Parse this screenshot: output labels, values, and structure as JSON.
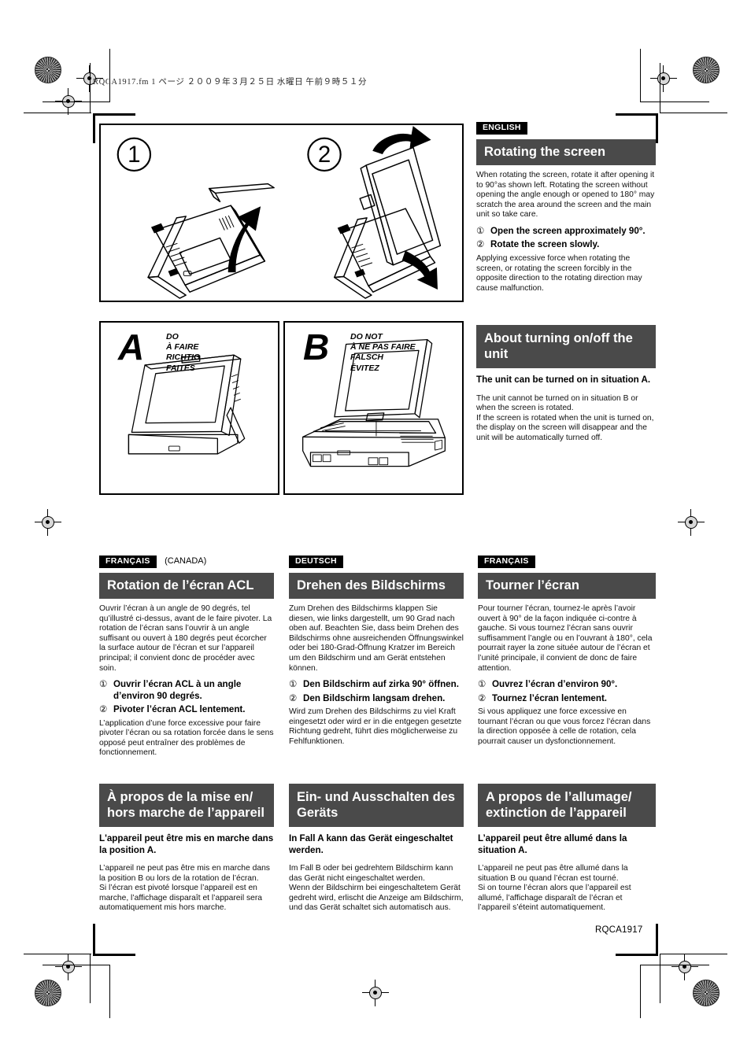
{
  "document": {
    "file_header": "RQCA1917.fm   1 ページ   ２００９年３月２５日   水曜日   午前９時５１分",
    "part_number": "RQCA1917"
  },
  "figures": {
    "rotate_panel": {
      "step1_marker": "1",
      "step2_marker": "2"
    },
    "situation_a": {
      "letter": "A",
      "caption": "DO\nÀ FAIRE\nRICHTIG\nFAITES"
    },
    "situation_b": {
      "letter": "B",
      "caption": "DO NOT\nÀ NE PAS FAIRE\nFALSCH\nÉVITEZ"
    }
  },
  "sections": {
    "english_rotate": {
      "lang_tag": "ENGLISH",
      "lang_tag_extra": "",
      "heading": "Rotating the screen",
      "intro": "When rotating the screen, rotate it after opening it to 90°as shown left. Rotating the screen without opening the angle enough or opened to 180° may scratch the area around the screen and the main unit so take care.",
      "steps": [
        {
          "num": "①",
          "label": "Open the screen approximately 90°."
        },
        {
          "num": "②",
          "label": "Rotate the screen slowly."
        }
      ],
      "outro": "Applying excessive force when rotating the screen, or rotating the screen forcibly in the opposite direction to the rotating direction may cause malfunction."
    },
    "english_power": {
      "heading": "About turning on/off the unit",
      "lead": "The unit can be turned on in situation A.",
      "body": "The unit cannot be turned on in situation B or when the screen is rotated.\nIf the screen is rotated when the unit is turned on, the display on the screen will disappear and the unit will be automatically turned off."
    },
    "french_ca_rotate": {
      "lang_tag": "FRANÇAIS",
      "lang_tag_extra": "(CANADA)",
      "heading": "Rotation de l’écran ACL",
      "intro": "Ouvrir l’écran à un angle de 90 degrés, tel qu’illustré ci-dessus, avant de le faire pivoter. La rotation de l’écran sans l’ouvrir à un angle suffisant ou ouvert à 180 degrés peut écorcher la surface autour de l’écran et sur l’appareil principal; il convient donc de procéder avec soin.",
      "steps": [
        {
          "num": "①",
          "label": "Ouvrir l’écran ACL à un angle d’environ 90 degrés."
        },
        {
          "num": "②",
          "label": "Pivoter l’écran ACL lentement."
        }
      ],
      "outro": "L’application d’une force excessive pour faire pivoter l’écran ou sa rotation forcée dans le sens opposé peut entraîner des problèmes de fonctionnement."
    },
    "german_rotate": {
      "lang_tag": "DEUTSCH",
      "lang_tag_extra": "",
      "heading": "Drehen des Bildschirms",
      "intro": "Zum Drehen des Bildschirms klappen Sie diesen, wie links dargestellt, um 90 Grad nach oben auf.  Beachten Sie, dass beim Drehen des Bildschirms ohne ausreichenden Öffnungswinkel oder bei 180-Grad-Öffnung Kratzer im Bereich um den Bildschirm und am Gerät entstehen können.",
      "steps": [
        {
          "num": "①",
          "label": "Den Bildschirm auf zirka 90° öffnen."
        },
        {
          "num": "②",
          "label": "Den Bildschirm langsam drehen."
        }
      ],
      "outro": "Wird zum Drehen des Bildschirms zu viel Kraft eingesetzt oder wird er in die entgegen gesetzte Richtung gedreht, führt dies möglicherweise zu Fehlfunktionen."
    },
    "french_rotate": {
      "lang_tag": "FRANÇAIS",
      "lang_tag_extra": "",
      "heading": "Tourner l’écran",
      "intro": "Pour tourner l’écran, tournez-le après l’avoir ouvert à 90° de la façon indiquée ci-contre à gauche. Si vous tournez l’écran sans ouvrir suffisamment l’angle ou en l’ouvrant à 180°, cela pourrait rayer la zone située autour de l’écran et l’unité principale, il convient de donc de faire attention.",
      "steps": [
        {
          "num": "①",
          "label": "Ouvrez l’écran d’environ 90°."
        },
        {
          "num": "②",
          "label": "Tournez l’écran lentement."
        }
      ],
      "outro": "Si vous appliquez une force excessive en tournant l’écran ou que vous forcez l’écran dans la direction opposée à celle de rotation, cela pourrait causer un dysfonctionnement."
    },
    "french_ca_power": {
      "heading": "À propos de la mise en/ hors marche de l’appareil",
      "lead": "L'appareil peut être mis en marche dans la position A.",
      "body": "L’appareil ne peut pas être mis en marche dans la position B ou lors de la rotation de l’écran.\nSi l’écran est pivoté lorsque l’appareil est en marche, l’affichage disparaît et l’appareil sera automatiquement mis hors marche."
    },
    "german_power": {
      "heading": "Ein- und Ausschalten des Geräts",
      "lead": "In Fall A kann das Gerät eingeschaltet werden.",
      "body": "Im Fall B oder bei gedrehtem Bildschirm kann das Gerät nicht eingeschaltet werden.\nWenn der Bildschirm bei eingeschaltetem Gerät gedreht wird, erlischt die Anzeige am Bildschirm, und das Gerät schaltet sich automatisch aus."
    },
    "french_power": {
      "heading": "A propos de l’allumage/ extinction de l’appareil",
      "lead": "L’appareil peut être allumé dans la situation A.",
      "body": "L’appareil ne peut pas être allumé dans la situation B ou quand l’écran est tourné.\nSi on tourne l’écran alors que l’appareil est allumé, l’affichage disparaît de l’écran et l’appareil s’éteint automatiquement."
    }
  },
  "colors": {
    "heading_bar": "#4a4a4a",
    "lang_tag_bg": "#000000",
    "page_bg": "#ffffff"
  }
}
